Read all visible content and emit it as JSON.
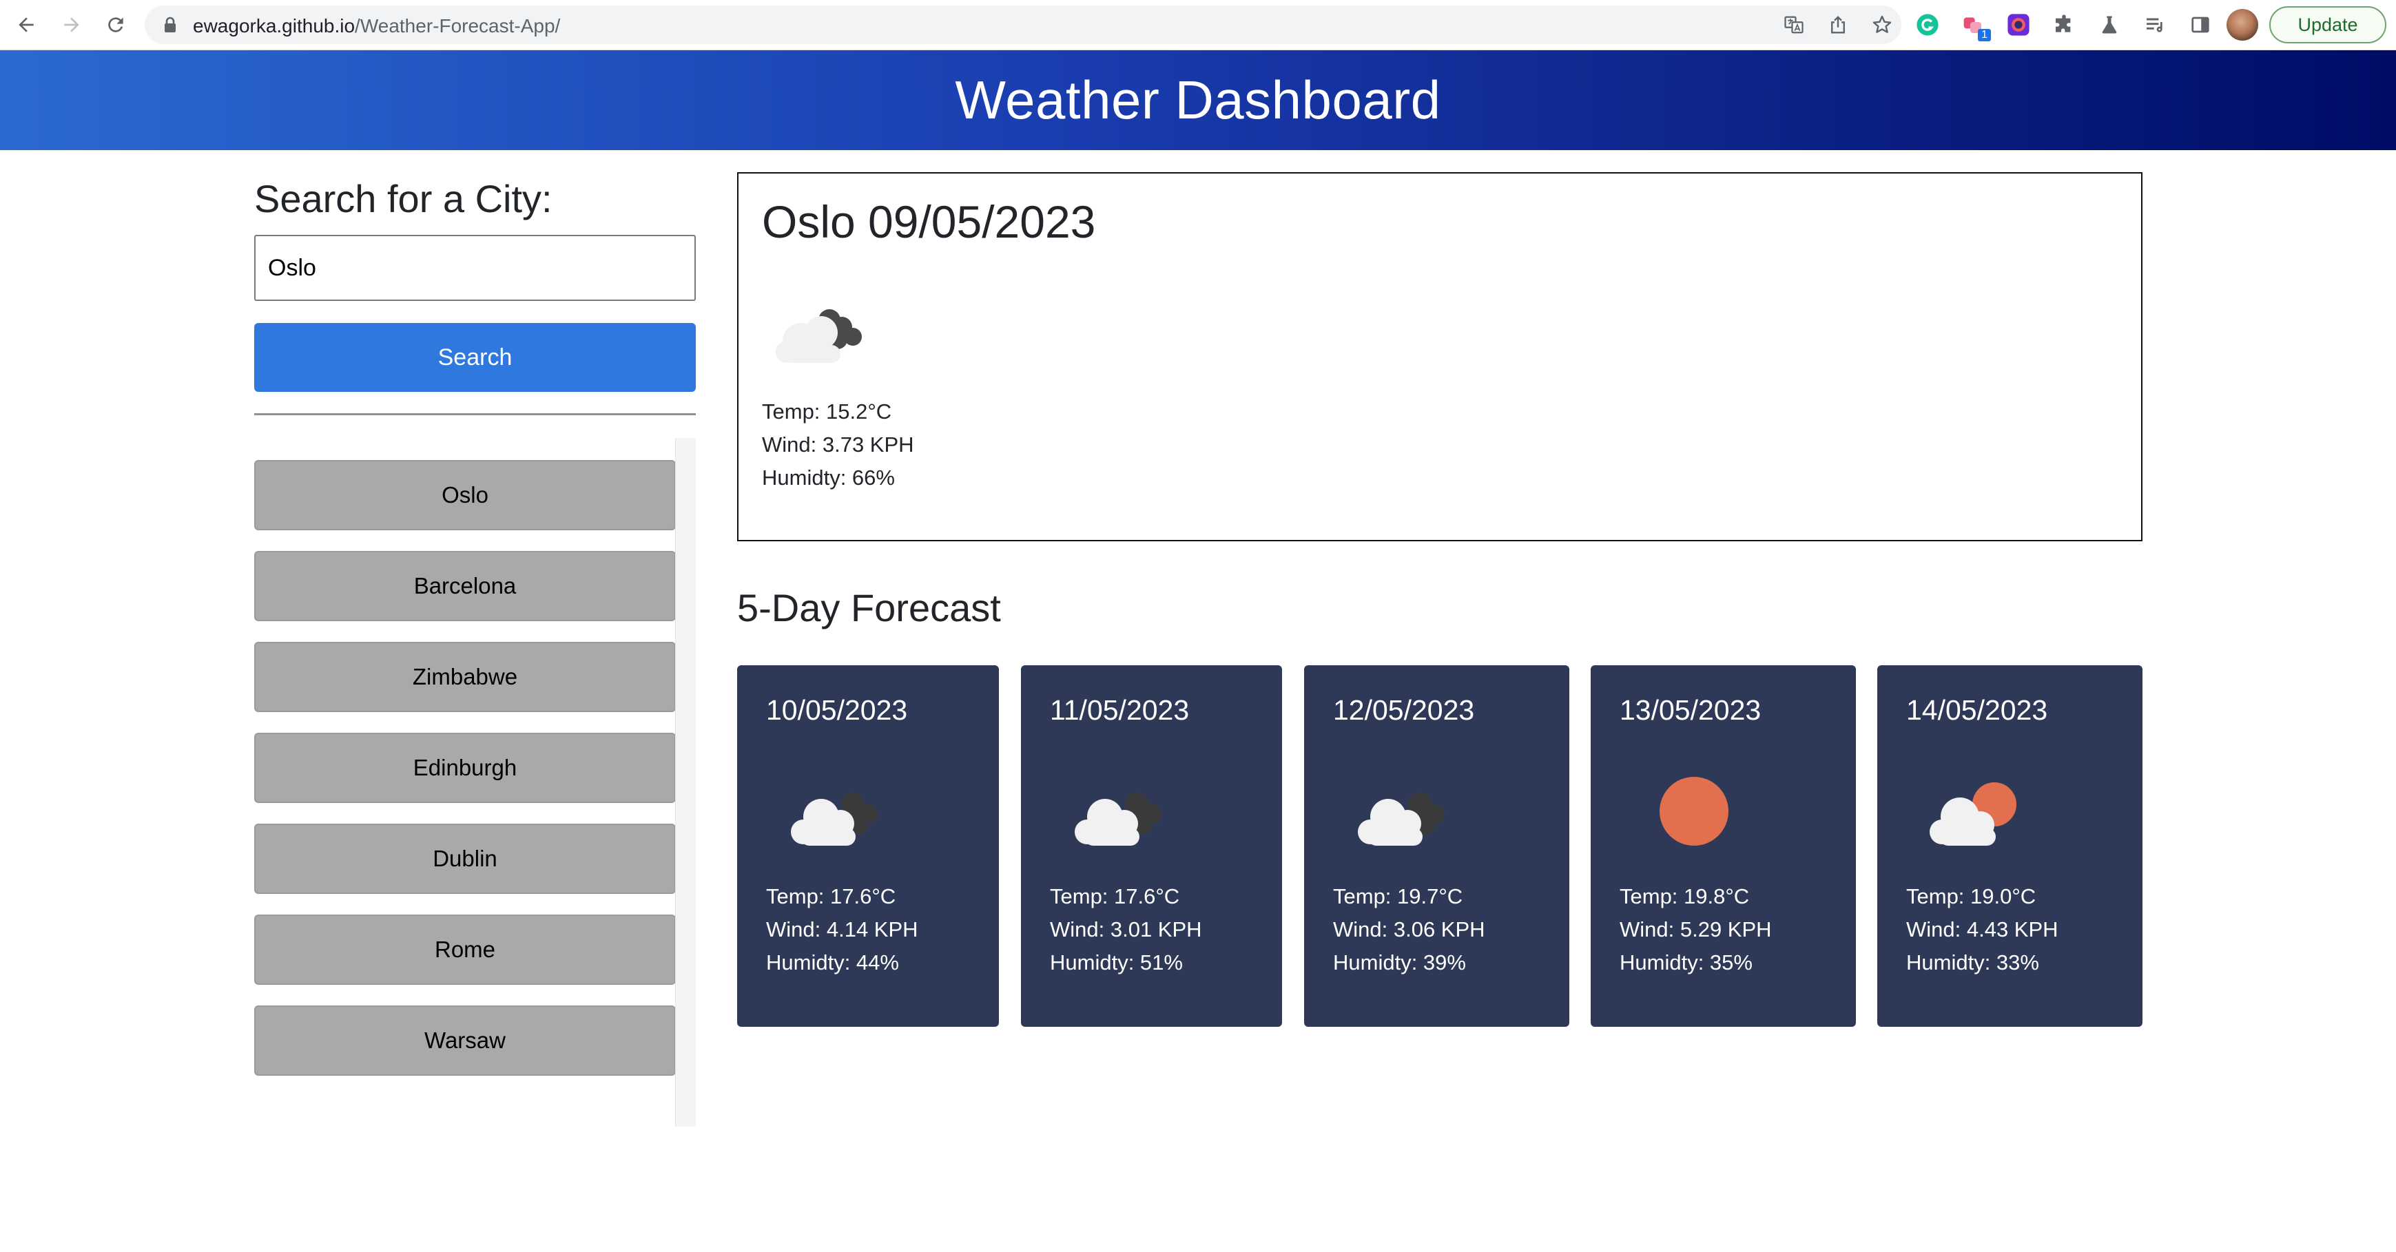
{
  "browser": {
    "url_host": "ewagorka.github.io",
    "url_path": "/Weather-Forecast-App/",
    "update_label": "Update",
    "extension_badge": "1"
  },
  "header": {
    "title": "Weather Dashboard"
  },
  "sidebar": {
    "search_heading": "Search for a City:",
    "input_value": "Oslo",
    "search_label": "Search",
    "history": [
      "Oslo",
      "Barcelona",
      "Zimbabwe",
      "Edinburgh",
      "Dublin",
      "Rome",
      "Warsaw"
    ]
  },
  "current": {
    "title": "Oslo 09/05/2023",
    "icon": "broken-clouds-icon",
    "temp": "Temp: 15.2°C",
    "wind": "Wind: 3.73 KPH",
    "humidity": "Humidty: 66%"
  },
  "forecast": {
    "heading": "5-Day Forecast",
    "days": [
      {
        "date": "10/05/2023",
        "icon": "broken-clouds-icon",
        "temp": "Temp: 17.6°C",
        "wind": "Wind: 4.14 KPH",
        "humidity": "Humidty: 44%"
      },
      {
        "date": "11/05/2023",
        "icon": "broken-clouds-icon",
        "temp": "Temp: 17.6°C",
        "wind": "Wind: 3.01 KPH",
        "humidity": "Humidty: 51%"
      },
      {
        "date": "12/05/2023",
        "icon": "broken-clouds-icon",
        "temp": "Temp: 19.7°C",
        "wind": "Wind: 3.06 KPH",
        "humidity": "Humidty: 39%"
      },
      {
        "date": "13/05/2023",
        "icon": "clear-sky-icon",
        "temp": "Temp: 19.8°C",
        "wind": "Wind: 5.29 KPH",
        "humidity": "Humidty: 35%"
      },
      {
        "date": "14/05/2023",
        "icon": "few-clouds-icon",
        "temp": "Temp: 19.0°C",
        "wind": "Wind: 4.43 KPH",
        "humidity": "Humidty: 33%"
      }
    ]
  },
  "colors": {
    "header_gradient_start": "#2a6ad1",
    "header_gradient_end": "#000c66",
    "search_button": "#2f79de",
    "history_button": "#a9a9a9",
    "forecast_card": "#2d3956",
    "sun": "#e2704f"
  }
}
